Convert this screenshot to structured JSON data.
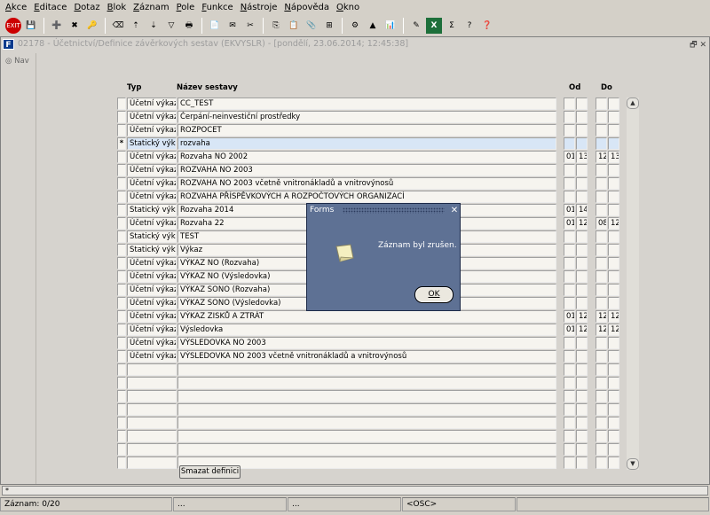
{
  "menu": [
    "Akce",
    "Editace",
    "Dotaz",
    "Blok",
    "Záznam",
    "Pole",
    "Funkce",
    "Nástroje",
    "Nápověda",
    "Okno"
  ],
  "toolbar_icons": [
    "exit-icon",
    "save-icon",
    "add-icon",
    "delete-icon",
    "key-icon",
    "clear-icon",
    "sort-asc-icon",
    "sort-desc-icon",
    "filter-icon",
    "print-icon",
    "document-icon",
    "mail-icon",
    "cut-icon",
    "copy-icon",
    "paste-icon",
    "attach-icon",
    "tree-icon",
    "settings-icon",
    "triangle-icon",
    "report-icon",
    "edit-icon",
    "excel-icon",
    "sum-icon",
    "question-icon",
    "help-icon"
  ],
  "window": {
    "title": "02178 - Účetnictví/Definice závěrkových sestav (EKVYSLR) - [pondělí, 23.06.2014; 12:45:38]",
    "nav_label": "Nav"
  },
  "columns": {
    "typ": "Typ",
    "nazev": "Název sestavy",
    "od": "Od",
    "do": "Do"
  },
  "rows": [
    {
      "ind": "",
      "typ": "Účetní výkaz",
      "nazev": "CC_TEST",
      "od1": "",
      "od2": "",
      "do1": "",
      "do2": ""
    },
    {
      "ind": "",
      "typ": "Účetní výkaz",
      "nazev": "Čerpání-neinvestiční prostředky",
      "od1": "",
      "od2": "",
      "do1": "",
      "do2": ""
    },
    {
      "ind": "",
      "typ": "Účetní výkaz",
      "nazev": "ROZPOCET",
      "od1": "",
      "od2": "",
      "do1": "",
      "do2": ""
    },
    {
      "ind": "*",
      "typ": "Statický výkaz",
      "nazev": "rozvaha",
      "od1": "",
      "od2": "",
      "do1": "",
      "do2": "",
      "selected": true
    },
    {
      "ind": "",
      "typ": "Účetní výkaz",
      "nazev": "Rozvaha NO 2002",
      "od1": "01",
      "od2": "13",
      "do1": "12",
      "do2": "13"
    },
    {
      "ind": "",
      "typ": "Účetní výkaz",
      "nazev": "ROZVAHA NO 2003",
      "od1": "",
      "od2": "",
      "do1": "",
      "do2": ""
    },
    {
      "ind": "",
      "typ": "Účetní výkaz",
      "nazev": "ROZVAHA NO 2003 včetně vnitronákladů a vnitrovýnosů",
      "od1": "",
      "od2": "",
      "do1": "",
      "do2": ""
    },
    {
      "ind": "",
      "typ": "Účetní výkaz",
      "nazev": "ROZVAHA PŘÍSPĚVKOVÝCH A ROZPOČTOVÝCH ORGANIZACÍ",
      "od1": "",
      "od2": "",
      "do1": "",
      "do2": ""
    },
    {
      "ind": "",
      "typ": "Statický výkaz",
      "nazev": "Rozvaha 2014",
      "od1": "01",
      "od2": "14",
      "do1": "",
      "do2": ""
    },
    {
      "ind": "",
      "typ": "Účetní výkaz",
      "nazev": "Rozvaha 22",
      "od1": "01",
      "od2": "12",
      "do1": "08",
      "do2": "12"
    },
    {
      "ind": "",
      "typ": "Statický výkaz",
      "nazev": "TEST",
      "od1": "",
      "od2": "",
      "do1": "",
      "do2": ""
    },
    {
      "ind": "",
      "typ": "Statický výkaz",
      "nazev": "Výkaz",
      "od1": "",
      "od2": "",
      "do1": "",
      "do2": ""
    },
    {
      "ind": "",
      "typ": "Účetní výkaz",
      "nazev": "VÝKAZ NO (Rozvaha)",
      "od1": "",
      "od2": "",
      "do1": "",
      "do2": ""
    },
    {
      "ind": "",
      "typ": "Účetní výkaz",
      "nazev": "VÝKAZ NO (Výsledovka)",
      "od1": "",
      "od2": "",
      "do1": "",
      "do2": ""
    },
    {
      "ind": "",
      "typ": "Účetní výkaz",
      "nazev": "VÝKAZ SONO (Rozvaha)",
      "od1": "",
      "od2": "",
      "do1": "",
      "do2": ""
    },
    {
      "ind": "",
      "typ": "Účetní výkaz",
      "nazev": "VÝKAZ SONO (Výsledovka)",
      "od1": "",
      "od2": "",
      "do1": "",
      "do2": ""
    },
    {
      "ind": "",
      "typ": "Účetní výkaz",
      "nazev": "VÝKAZ ZISKŮ A ZTRÁT",
      "od1": "01",
      "od2": "12",
      "do1": "12",
      "do2": "12"
    },
    {
      "ind": "",
      "typ": "Účetní výkaz",
      "nazev": "Výsledovka",
      "od1": "01",
      "od2": "12",
      "do1": "12",
      "do2": "12"
    },
    {
      "ind": "",
      "typ": "Účetní výkaz",
      "nazev": "VÝSLEDOVKA NO 2003",
      "od1": "",
      "od2": "",
      "do1": "",
      "do2": ""
    },
    {
      "ind": "",
      "typ": "Účetní výkaz",
      "nazev": "VÝSLEDOVKA NO 2003 včetně vnitronákladů a vnitrovýnosů",
      "od1": "",
      "od2": "",
      "do1": "",
      "do2": ""
    },
    {
      "ind": "",
      "typ": "",
      "nazev": "",
      "od1": "",
      "od2": "",
      "do1": "",
      "do2": ""
    },
    {
      "ind": "",
      "typ": "",
      "nazev": "",
      "od1": "",
      "od2": "",
      "do1": "",
      "do2": ""
    },
    {
      "ind": "",
      "typ": "",
      "nazev": "",
      "od1": "",
      "od2": "",
      "do1": "",
      "do2": ""
    },
    {
      "ind": "",
      "typ": "",
      "nazev": "",
      "od1": "",
      "od2": "",
      "do1": "",
      "do2": ""
    },
    {
      "ind": "",
      "typ": "",
      "nazev": "",
      "od1": "",
      "od2": "",
      "do1": "",
      "do2": ""
    },
    {
      "ind": "",
      "typ": "",
      "nazev": "",
      "od1": "",
      "od2": "",
      "do1": "",
      "do2": ""
    },
    {
      "ind": "",
      "typ": "",
      "nazev": "",
      "od1": "",
      "od2": "",
      "do1": "",
      "do2": ""
    },
    {
      "ind": "",
      "typ": "",
      "nazev": "",
      "od1": "",
      "od2": "",
      "do1": "",
      "do2": ""
    }
  ],
  "delete_button": "Smazat definici",
  "status": {
    "top": "*",
    "record": "Záznam: 0/20",
    "seg2": "...",
    "seg3": "...",
    "seg4": "<OSC>"
  },
  "dialog": {
    "title": "Forms",
    "message": "Záznam byl zrušen.",
    "ok": "OK"
  },
  "colors": {
    "dialog_bg": "#5e7194",
    "selected_row": "#d8e6f6",
    "title_text": "#9c9c9c"
  }
}
